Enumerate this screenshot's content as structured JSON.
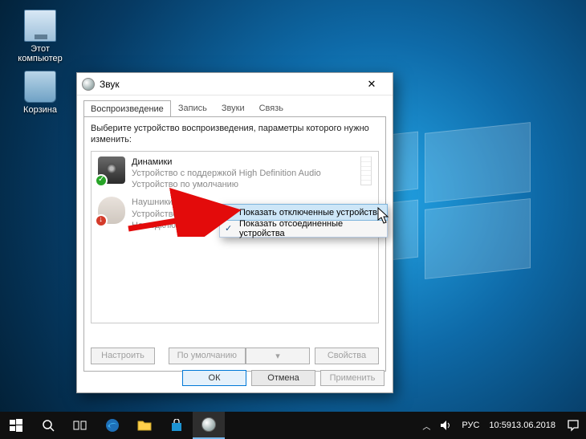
{
  "desktop": {
    "icons": [
      {
        "id": "this-pc",
        "label": "Этот\nкомпьютер"
      },
      {
        "id": "recycle-bin",
        "label": "Корзина"
      }
    ]
  },
  "dialog": {
    "title": "Звук",
    "tabs": [
      "Воспроизведение",
      "Запись",
      "Звуки",
      "Связь"
    ],
    "active_tab": 0,
    "instruction": "Выберите устройство воспроизведения, параметры которого нужно изменить:",
    "devices": [
      {
        "name": "Динамики",
        "line2": "Устройство с поддержкой High Definition Audio",
        "line3": "Устройство по умолчанию",
        "status": "default"
      },
      {
        "name": "Наушники",
        "line2": "Устройство с поддержкой High Definition Audio",
        "line3": "Не подключено",
        "status": "disconnected"
      }
    ],
    "buttons": {
      "configure": "Настроить",
      "set_default": "По умолчанию",
      "properties": "Свойства",
      "ok": "ОК",
      "cancel": "Отмена",
      "apply": "Применить"
    }
  },
  "context_menu": {
    "items": [
      {
        "label": "Показать отключенные устройства",
        "checked": false,
        "highlighted": true
      },
      {
        "label": "Показать отсоединенные устройства",
        "checked": true,
        "highlighted": false
      }
    ]
  },
  "taskbar": {
    "lang": "РУС",
    "time": "10:59",
    "date": "13.06.2018"
  }
}
